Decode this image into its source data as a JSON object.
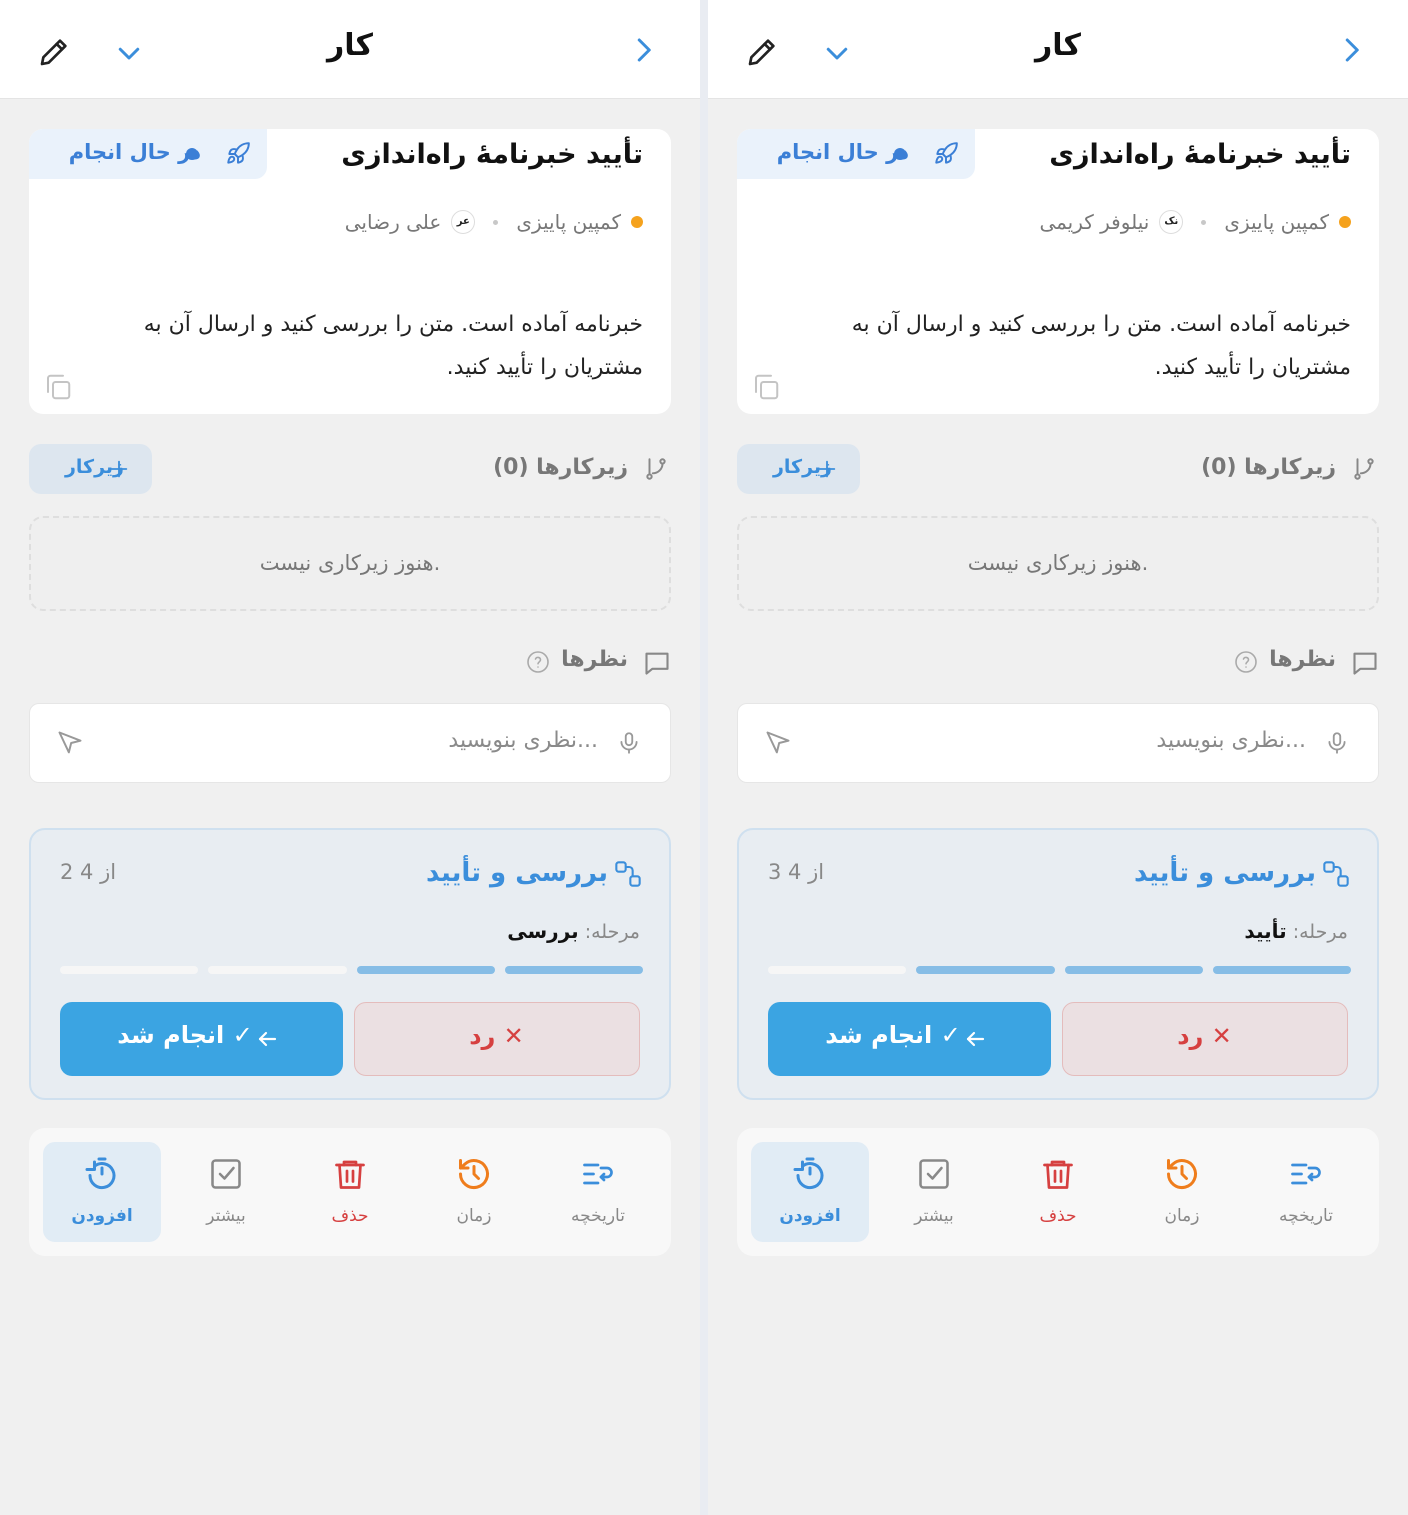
{
  "panels": [
    {
      "header": {
        "title": "کار"
      },
      "task": {
        "title": "تأیید خبرنامهٔ راه‌اندازی",
        "status": "در حال انجام",
        "project": "کمپین پاییزی",
        "assignee_initials": "عر",
        "assignee": "علی رضایی",
        "description": "خبرنامه آماده است. متن را بررسی کنید و ارسال آن به مشتریان را تأیید کنید."
      },
      "subtasks": {
        "title": "زیرکارها (0)",
        "add_label": "زیرکار",
        "empty": "هنوز زیرکاری نیست."
      },
      "comments": {
        "title": "نظرها",
        "placeholder": "نظری بنویسید..."
      },
      "workflow": {
        "title": "بررسی و تأیید",
        "counter": "2 از 4",
        "stage_label": "مرحله:",
        "stage_value": "بررسی",
        "completed_steps": 2,
        "total_steps": 4,
        "reject_label": "رد ✕",
        "done_label": "انجام شد ✓"
      },
      "toolbar": [
        {
          "label": "تاریخچه",
          "icon": "history-list-icon"
        },
        {
          "label": "زمان",
          "icon": "clock-history-icon"
        },
        {
          "label": "حذف",
          "icon": "trash-icon"
        },
        {
          "label": "بیشتر",
          "icon": "checkbox-icon"
        },
        {
          "label": "افزودن",
          "icon": "timer-add-icon"
        }
      ]
    },
    {
      "header": {
        "title": "کار"
      },
      "task": {
        "title": "تأیید خبرنامهٔ راه‌اندازی",
        "status": "در حال انجام",
        "project": "کمپین پاییزی",
        "assignee_initials": "نک",
        "assignee": "نیلوفر کریمی",
        "description": "خبرنامه آماده است. متن را بررسی کنید و ارسال آن به مشتریان را تأیید کنید."
      },
      "subtasks": {
        "title": "زیرکارها (0)",
        "add_label": "زیرکار",
        "empty": "هنوز زیرکاری نیست."
      },
      "comments": {
        "title": "نظرها",
        "placeholder": "نظری بنویسید..."
      },
      "workflow": {
        "title": "بررسی و تأیید",
        "counter": "3 از 4",
        "stage_label": "مرحله:",
        "stage_value": "تأیید",
        "completed_steps": 3,
        "total_steps": 4,
        "reject_label": "رد ✕",
        "done_label": "انجام شد ✓"
      },
      "toolbar": [
        {
          "label": "تاریخچه",
          "icon": "history-list-icon"
        },
        {
          "label": "زمان",
          "icon": "clock-history-icon"
        },
        {
          "label": "حذف",
          "icon": "trash-icon"
        },
        {
          "label": "بیشتر",
          "icon": "checkbox-icon"
        },
        {
          "label": "افزودن",
          "icon": "timer-add-icon"
        }
      ]
    }
  ],
  "colors": {
    "accent": "#3b8edb",
    "status": "#3b7fd6",
    "project_dot": "#f5a21d",
    "danger": "#d64040",
    "done_button": "#3ba4e2",
    "time_icon": "#ef7d1c"
  }
}
